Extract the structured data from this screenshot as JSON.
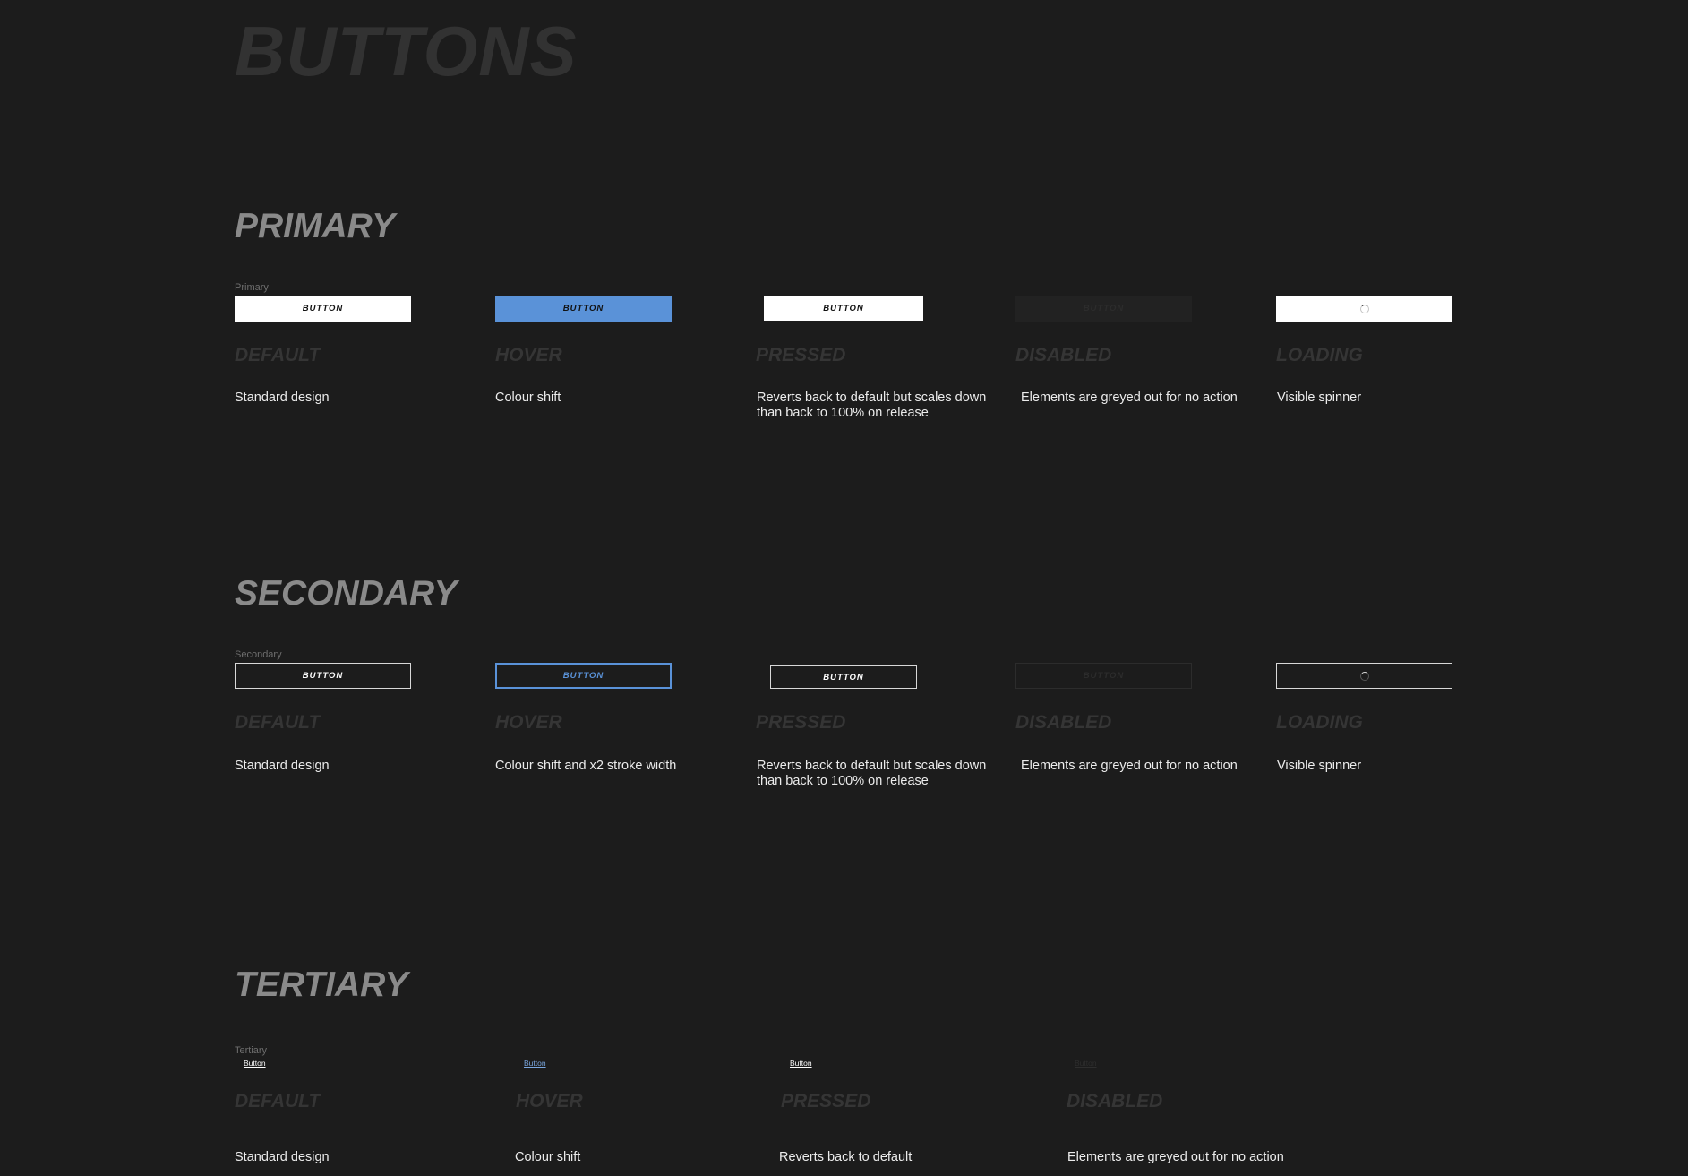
{
  "page_title": "BUTTONS",
  "button_label": "BUTTON",
  "colors": {
    "background": "#1c1c1c",
    "accent": "#5a92d8"
  },
  "states": {
    "default": "DEFAULT",
    "hover": "HOVER",
    "pressed": "PRESSED",
    "disabled": "DISABLED",
    "loading": "LOADING"
  },
  "primary": {
    "title": "PRIMARY",
    "component_label": "Primary",
    "descriptions": {
      "default": "Standard design",
      "hover": "Colour shift",
      "pressed": "Reverts back to default but scales down than back to 100% on release",
      "disabled": "Elements are greyed out for no action",
      "loading": "Visible spinner"
    }
  },
  "secondary": {
    "title": "SECONDARY",
    "component_label": "Secondary",
    "descriptions": {
      "default": "Standard design",
      "hover": "Colour shift and x2 stroke width",
      "pressed": "Reverts back to default but scales down than back to 100% on release",
      "disabled": "Elements are greyed out for no action",
      "loading": "Visible spinner"
    }
  },
  "tertiary": {
    "title": "TERTIARY",
    "component_label": "Tertiary",
    "link_label": "Button",
    "descriptions": {
      "default": "Standard design",
      "hover": "Colour shift",
      "pressed": "Reverts back to default",
      "disabled": "Elements are greyed out for no action"
    }
  }
}
